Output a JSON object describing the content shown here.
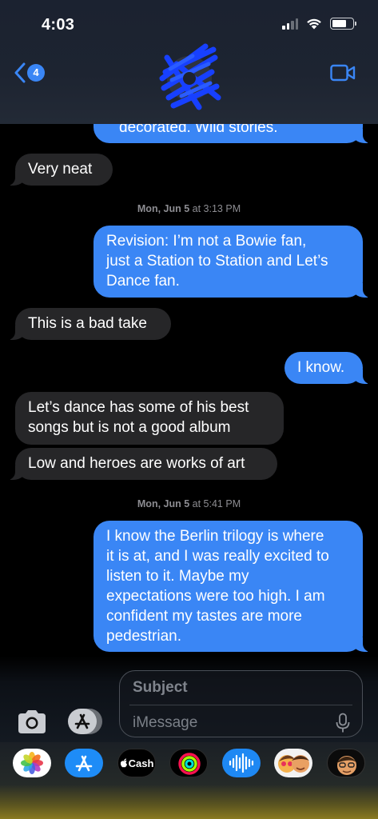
{
  "status_bar": {
    "time": "4:03"
  },
  "header": {
    "back_count": "4"
  },
  "messages": [
    {
      "id": "m0",
      "direction": "out",
      "text": "decorated. Wild stories."
    },
    {
      "id": "m1",
      "direction": "in",
      "text": "Very neat"
    },
    {
      "id": "t1",
      "type": "timestamp",
      "day": "Mon, Jun 5",
      "time": "at 3:13 PM"
    },
    {
      "id": "m2",
      "direction": "out",
      "lines": [
        "Revision: I’m not a Bowie fan,",
        "just a Station to Station and Let’s",
        "Dance fan."
      ]
    },
    {
      "id": "m3",
      "direction": "in",
      "text": "This is a bad take"
    },
    {
      "id": "m4",
      "direction": "out",
      "text": "I know."
    },
    {
      "id": "m5",
      "direction": "in",
      "lines": [
        "Let’s dance has some of his best",
        "songs but is not a good album"
      ]
    },
    {
      "id": "m6",
      "direction": "in",
      "text": "Low and heroes are works of art"
    },
    {
      "id": "t2",
      "type": "timestamp",
      "day": "Mon, Jun 5",
      "time": "at 5:41 PM"
    },
    {
      "id": "m7",
      "direction": "out",
      "lines": [
        "I know the Berlin trilogy is where",
        "it is at, and I was really excited to",
        "listen to it. Maybe my",
        "expectations were too high. I am",
        "confident my tastes are more",
        "pedestrian."
      ]
    }
  ],
  "compose": {
    "subject_placeholder": "Subject",
    "message_placeholder": "iMessage"
  },
  "app_drawer": {
    "apps": [
      {
        "name": "Photos",
        "icon": "photos-icon"
      },
      {
        "name": "App Store",
        "icon": "app-store-icon"
      },
      {
        "name": "Cash",
        "label": "Cash",
        "icon": "apple-cash-icon"
      },
      {
        "name": "Fitness",
        "icon": "fitness-rings-icon"
      },
      {
        "name": "Audio Message",
        "icon": "voice-waveform-icon"
      },
      {
        "name": "Memoji Stickers",
        "icon": "memoji-icon"
      },
      {
        "name": "Memoji",
        "icon": "memoji-icon"
      }
    ]
  },
  "colors": {
    "outgoing_bubble": "#3a86f5",
    "incoming_bubble": "#262628",
    "accent": "#3a86f5",
    "background": "#000000"
  }
}
